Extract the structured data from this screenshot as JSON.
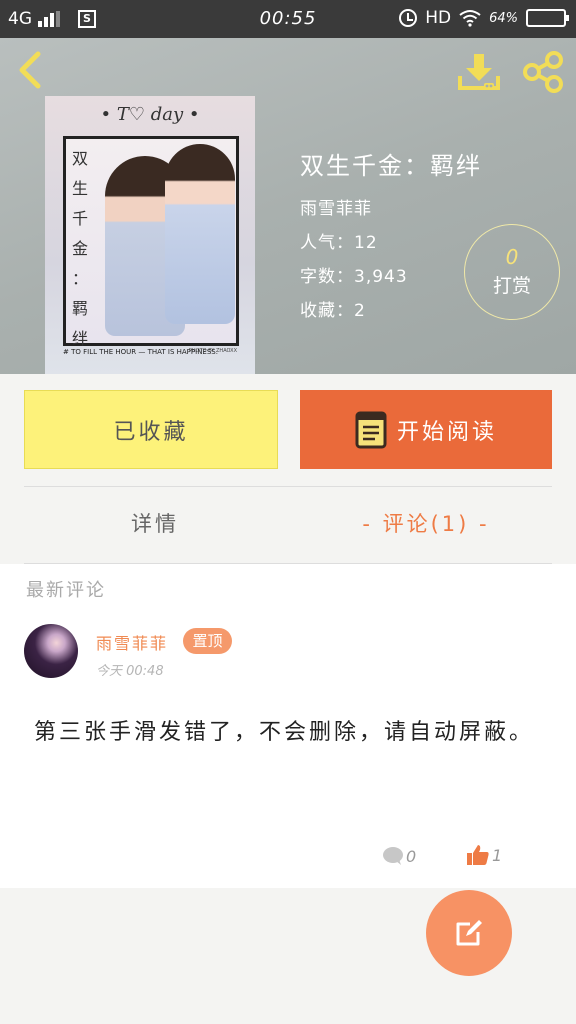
{
  "status_bar": {
    "network": "4G",
    "sim_label": "S",
    "time": "00:55",
    "hd": "HD",
    "battery_text": "64%",
    "battery_level": 0.64
  },
  "icons": {
    "back": "back-arrow-icon",
    "download": "download-icon",
    "share": "share-icon",
    "read": "book-icon",
    "reply": "comment-bubble-icon",
    "like": "thumbs-up-icon",
    "compose": "edit-icon"
  },
  "book": {
    "cover_today": "• T♡ day •",
    "cover_vertical": [
      "双",
      "生",
      "千",
      "金",
      "：",
      "羁",
      "绊"
    ],
    "cover_caption": "# TO FILL THE HOUR — THAT IS HAPPINESS.",
    "cover_credit": "PHOTO BY ZHAOXX",
    "title": "双生千金：羁绊",
    "author": "雨雪菲菲",
    "popularity": "人气：12",
    "word_count": "字数：3,943",
    "favorites": "收藏：2"
  },
  "reward": {
    "amount": "0",
    "label": "打赏"
  },
  "actions": {
    "favorited_label": "已收藏",
    "read_label": "开始阅读"
  },
  "tabs": {
    "detail": "详情",
    "comments": "- 评论(1) -"
  },
  "comments": {
    "section_label": "最新评论",
    "items": [
      {
        "username": "雨雪菲菲",
        "badge": "置顶",
        "time": "今天 00:48",
        "text": "第三张手滑发错了，不会删除，请自动屏蔽。",
        "reply_count": "0",
        "like_count": "1"
      }
    ]
  },
  "colors": {
    "accent_orange": "#ea6a3a",
    "favorite_yellow": "#fdf27a",
    "header_gray": "#a9b0ae",
    "fab_orange": "#f79264"
  }
}
